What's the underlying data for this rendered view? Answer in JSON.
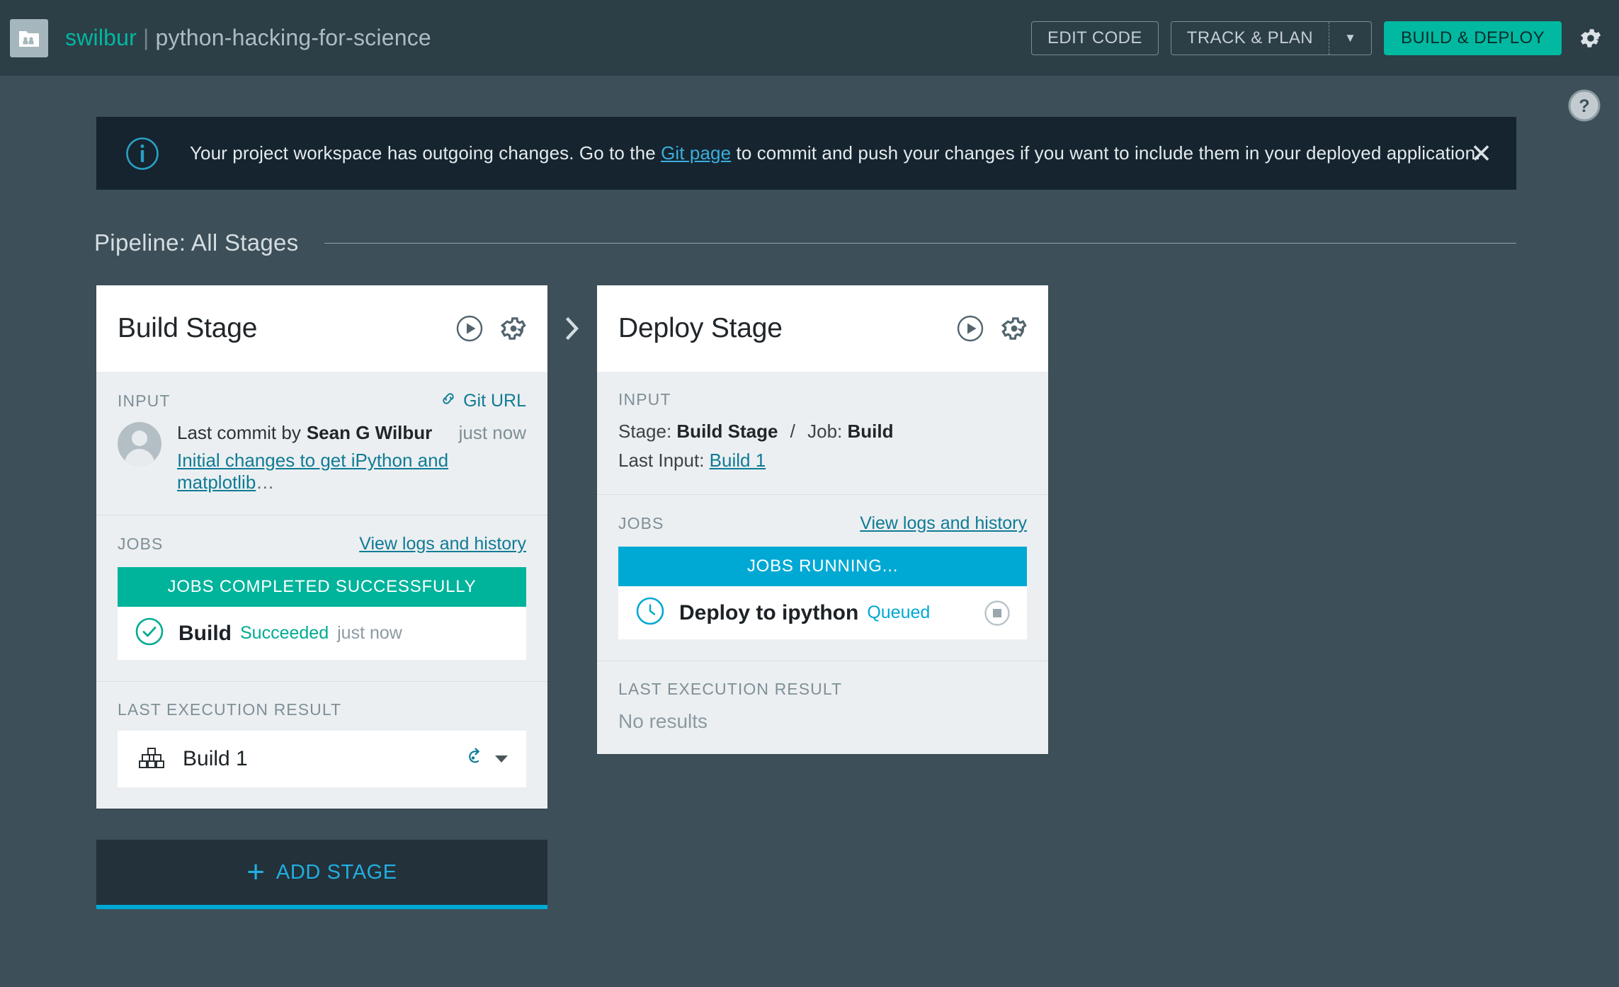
{
  "header": {
    "logo_icon": "project-folder-icon",
    "org": "swilbur",
    "separator": "|",
    "project": "python-hacking-for-science",
    "edit_code_label": "EDIT CODE",
    "track_plan_label": "TRACK & PLAN",
    "track_plan_caret": "▼",
    "build_deploy_label": "BUILD & DEPLOY",
    "settings_icon": "gear-icon",
    "help_icon": "help-question-icon",
    "colors": {
      "bar": "#2c3e46",
      "org_accent": "#00b8a0",
      "primary_button": "#00b9a0"
    }
  },
  "notification": {
    "icon": "info-icon",
    "text_before": "Your project workspace has outgoing changes. Go to the ",
    "link": "Git page",
    "text_after": " to commit and push your changes if you want to include them in your deployed application.",
    "close_label": "✕",
    "background": "#15242e",
    "link_color": "#3aaede"
  },
  "pipeline": {
    "title": "Pipeline: All Stages"
  },
  "stages": [
    {
      "name": "Build Stage",
      "run_icon": "play-circle-icon",
      "settings_icon": "gear-icon",
      "input": {
        "label": "INPUT",
        "link_icon": "chain-link-icon",
        "link_label": "Git URL",
        "avatar": "user-avatar",
        "commit_prefix": "Last commit by",
        "commit_author": "Sean G Wilbur",
        "commit_time": "just now",
        "commit_message": "Initial changes to get iPython and matplotlib",
        "commit_ellipsis": "…"
      },
      "jobs": {
        "label": "JOBS",
        "logs_link": "View logs and history",
        "status_bar": "JOBS COMPLETED SUCCESSFULLY",
        "status_color": "#00b39b",
        "items": [
          {
            "icon": "check-circle-icon",
            "name": "Build",
            "state": "Succeeded",
            "state_kind": "ok",
            "time": "just now"
          }
        ]
      },
      "result": {
        "label": "LAST EXECUTION RESULT",
        "icon": "build-blocks-icon",
        "name": "Build 1",
        "rerun_icon": "rerun-arrow-icon",
        "menu_icon": "chevron-down-icon"
      }
    },
    {
      "name": "Deploy Stage",
      "run_icon": "play-circle-icon",
      "settings_icon": "gear-icon",
      "input": {
        "label": "INPUT",
        "stage_key": "Stage:",
        "stage_value": "Build Stage",
        "slash": "/",
        "job_key": "Job:",
        "job_value": "Build",
        "last_input_key": "Last Input:",
        "last_input_value": "Build 1"
      },
      "jobs": {
        "label": "JOBS",
        "logs_link": "View logs and history",
        "status_bar": "JOBS RUNNING...",
        "status_color": "#00a9d4",
        "items": [
          {
            "icon": "clock-circle-icon",
            "name": "Deploy to ipython",
            "state": "Queued",
            "state_kind": "queued",
            "stop_icon": "stop-square-icon"
          }
        ]
      },
      "result": {
        "label": "LAST EXECUTION RESULT",
        "empty_text": "No results"
      }
    }
  ],
  "add_stage": {
    "plus": "+",
    "label": "ADD STAGE",
    "accent": "#00a9d4"
  }
}
